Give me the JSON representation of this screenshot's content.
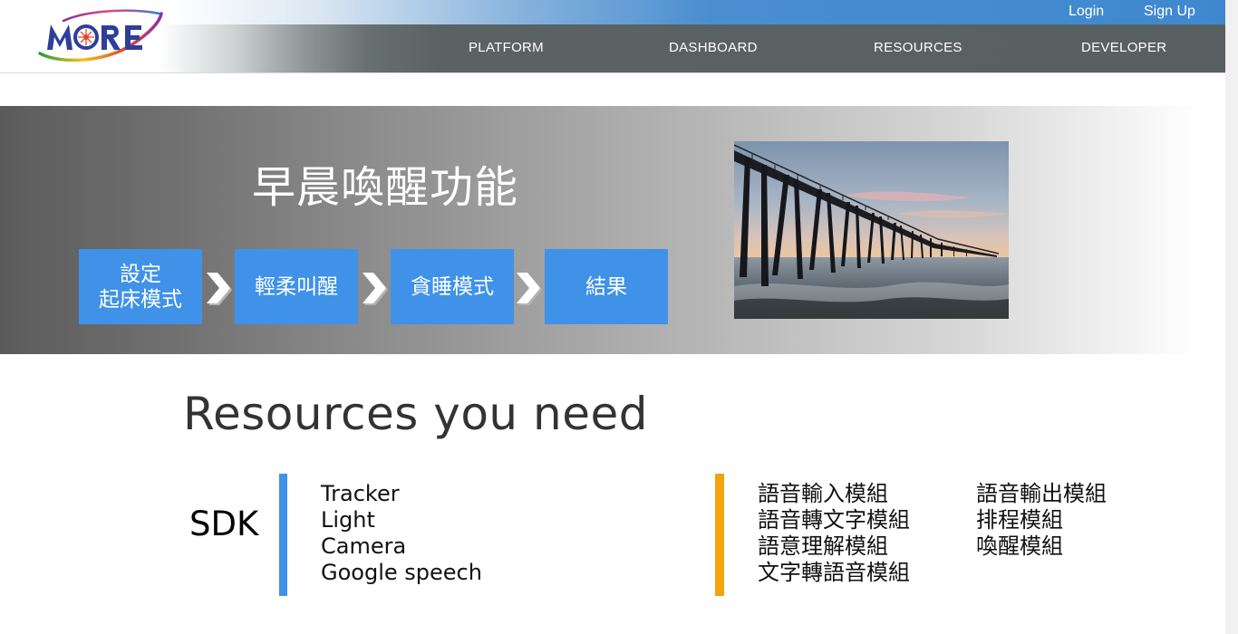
{
  "header": {
    "logo_text": "MORE",
    "auth": {
      "login": "Login",
      "signup": "Sign Up"
    },
    "nav": [
      {
        "label": "PLATFORM"
      },
      {
        "label": "DASHBOARD"
      },
      {
        "label": "RESOURCES"
      },
      {
        "label": "DEVELOPER"
      }
    ]
  },
  "hero": {
    "title": "早晨喚醒功能",
    "steps": [
      {
        "line1": "設定",
        "line2": "起床模式"
      },
      {
        "line1": "輕柔叫醒",
        "line2": ""
      },
      {
        "line1": "貪睡模式",
        "line2": ""
      },
      {
        "line1": "結果",
        "line2": ""
      }
    ],
    "step_color": "#3f92e8"
  },
  "resources": {
    "heading": "Resources you need",
    "sdk": {
      "label": "SDK",
      "accent": "#3f92e8",
      "items": [
        "Tracker",
        "Light",
        "Camera",
        "Google speech"
      ]
    },
    "modules": {
      "accent": "#f4a20d",
      "column1": [
        "語音輸入模組",
        "語音轉文字模組",
        "語意理解模組",
        "文字轉語音模組"
      ],
      "column2": [
        "語音輸出模組",
        "排程模組",
        "喚醒模組"
      ]
    }
  }
}
